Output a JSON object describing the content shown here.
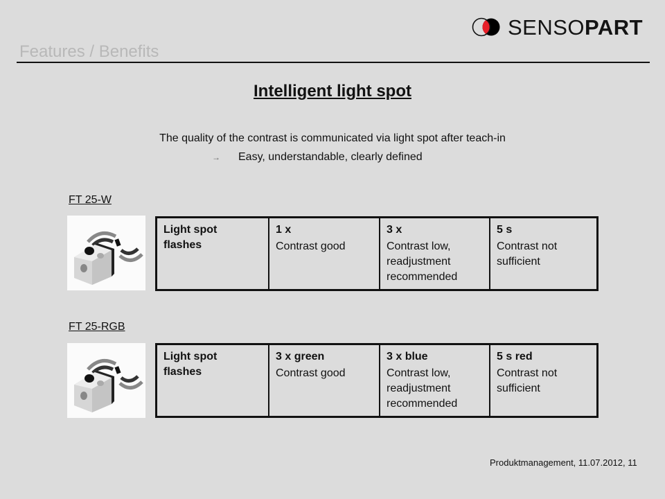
{
  "brand": {
    "name_light": "SENSO",
    "name_bold": "PART",
    "logo_colors": {
      "ring": "#111111",
      "fill": "#000000",
      "overlap": "#e8202a"
    }
  },
  "header": {
    "section_title": "Features / Benefits"
  },
  "main": {
    "title": "Intelligent light spot",
    "subtitle": "The quality of the contrast  is communicated via light spot after teach-in",
    "bullet": {
      "icon": "arrow-right-icon",
      "glyph": "→",
      "text": "Easy, understandable, clearly defined"
    }
  },
  "products": [
    {
      "label": "FT 25-W",
      "image_alt": "sensor-image",
      "table": {
        "row_label": "Light spot\nflashes",
        "columns": [
          {
            "head": "1 x",
            "body": "Contrast good"
          },
          {
            "head": "3 x",
            "body": "Contrast low,\nreadjustment\nrecommended"
          },
          {
            "head": "5 s",
            "body": "Contrast not\nsufficient"
          }
        ]
      }
    },
    {
      "label": "FT 25-RGB",
      "image_alt": "sensor-image",
      "table": {
        "row_label": "Light spot\nflashes",
        "columns": [
          {
            "head": "3 x green",
            "body": "Contrast good"
          },
          {
            "head": "3 x blue",
            "body": "Contrast low,\nreadjustment\nrecommended"
          },
          {
            "head": "5 s red",
            "body": "Contrast not\nsufficient"
          }
        ]
      }
    }
  ],
  "footer": {
    "text": "Produktmanagement, 11.07.2012,   11"
  }
}
